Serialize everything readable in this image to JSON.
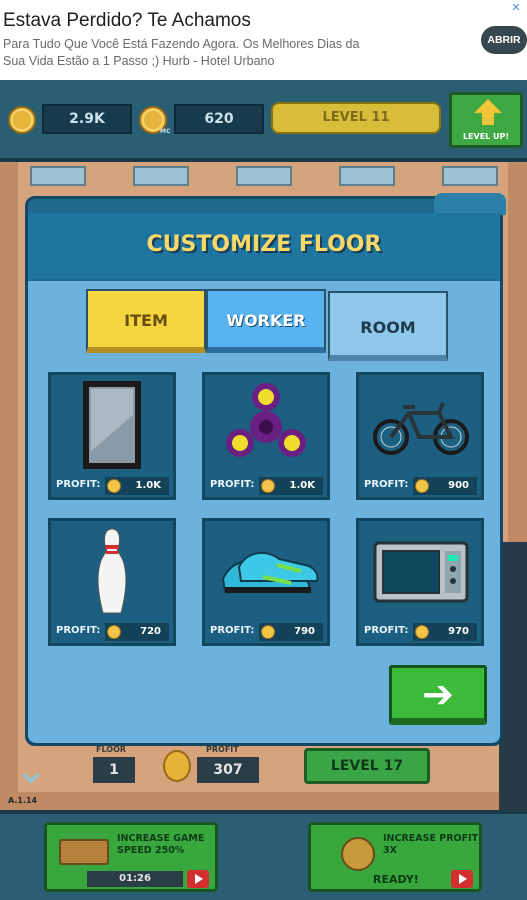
{
  "ad": {
    "title": "Estava Perdido? Te Achamos",
    "body": "Para Tudo Que Você Está Fazendo Agora. Os Melhores Dias da Sua Vida Estão a 1 Passo ;) Hurb - Hotel Urbano",
    "button": "ABRIR",
    "close_icon": "x"
  },
  "hud": {
    "coins": "2.9K",
    "mc_label": "MC",
    "mc": "620",
    "level": "LEVEL 11",
    "level_up": "LEVEL UP!"
  },
  "modal": {
    "title": "CUSTOMIZE FLOOR",
    "tabs": [
      {
        "label": "ITEM",
        "active": true
      },
      {
        "label": "WORKER",
        "active": false
      },
      {
        "label": "ROOM",
        "active": false
      }
    ],
    "profit_label": "PROFIT:",
    "items": [
      {
        "name": "mirror",
        "profit": "1.0K"
      },
      {
        "name": "fidget spinner",
        "profit": "1.0K"
      },
      {
        "name": "bicycle",
        "profit": "900"
      },
      {
        "name": "bowling pin",
        "profit": "720"
      },
      {
        "name": "sneakers",
        "profit": "790"
      },
      {
        "name": "microwave",
        "profit": "970"
      }
    ],
    "next_icon": "arrow-right"
  },
  "floor": {
    "floor_label": "FLOOR",
    "floor_value": "1",
    "profit_label": "PROFIT",
    "profit_value": "307",
    "level": "LEVEL 17"
  },
  "version": "A.1.14",
  "boosts": {
    "speed": {
      "title": "INCREASE GAME SPEED 250%",
      "timer": "01:26",
      "progress": 0.15
    },
    "profit": {
      "title": "INCREASE PROFIT 3X",
      "status": "READY!"
    }
  },
  "colors": {
    "accent_green": "#3cbb3a",
    "tab_active": "#f4d542",
    "title_yellow": "#f7d96a",
    "modal_blue": "#1f6a8c"
  }
}
